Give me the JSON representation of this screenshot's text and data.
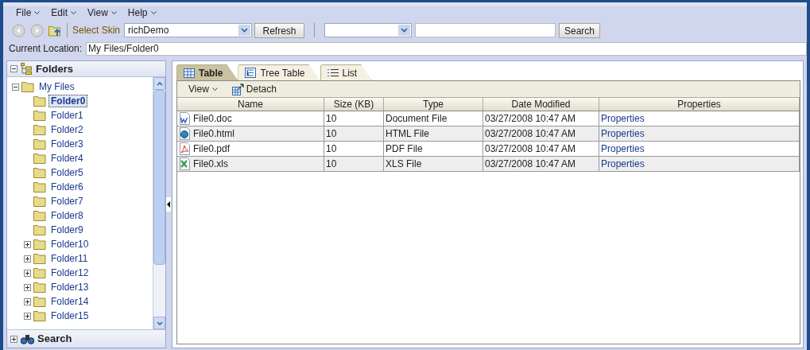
{
  "menu": [
    {
      "label": "File"
    },
    {
      "label": "Edit"
    },
    {
      "label": "View"
    },
    {
      "label": "Help"
    }
  ],
  "toolbar": {
    "skin_label": "Select Skin",
    "skin_value": "richDemo",
    "refresh": "Refresh",
    "search_button": "Search"
  },
  "location": {
    "label": "Current Location:",
    "value": "My Files/Folder0"
  },
  "folders_panel": {
    "title": "Folders",
    "expanded": true,
    "tree": [
      {
        "label": "My Files",
        "expanded": true,
        "selected": false,
        "children": [
          {
            "label": "Folder0",
            "selected": true
          },
          {
            "label": "Folder1",
            "selected": false
          },
          {
            "label": "Folder2",
            "selected": false
          },
          {
            "label": "Folder3",
            "selected": false
          },
          {
            "label": "Folder4",
            "selected": false
          },
          {
            "label": "Folder5",
            "selected": false
          },
          {
            "label": "Folder6",
            "selected": false
          },
          {
            "label": "Folder7",
            "selected": false
          },
          {
            "label": "Folder8",
            "selected": false
          },
          {
            "label": "Folder9",
            "selected": false
          },
          {
            "label": "Folder10",
            "selected": false,
            "expanded": false
          },
          {
            "label": "Folder11",
            "selected": false,
            "expanded": false
          },
          {
            "label": "Folder12",
            "selected": false,
            "expanded": false
          },
          {
            "label": "Folder13",
            "selected": false,
            "expanded": false
          },
          {
            "label": "Folder14",
            "selected": false,
            "expanded": false
          },
          {
            "label": "Folder15",
            "selected": false,
            "expanded": false
          }
        ]
      }
    ]
  },
  "search_panel": {
    "title": "Search",
    "expanded": false
  },
  "tabs": [
    {
      "label": "Table",
      "kind": "table",
      "selected": true
    },
    {
      "label": "Tree Table",
      "kind": "treetable",
      "selected": false
    },
    {
      "label": "List",
      "kind": "list",
      "selected": false
    }
  ],
  "table_toolbar": {
    "view": "View",
    "detach": "Detach"
  },
  "table": {
    "columns": [
      "Name",
      "Size (KB)",
      "Type",
      "Date Modified",
      "Properties"
    ],
    "rows": [
      {
        "kind": "doc",
        "name": "File0.doc",
        "size": "10",
        "type": "Document File",
        "date": "03/27/2008 10:47 AM",
        "link": "Properties"
      },
      {
        "kind": "html",
        "name": "File0.html",
        "size": "10",
        "type": "HTML File",
        "date": "03/27/2008 10:47 AM",
        "link": "Properties"
      },
      {
        "kind": "pdf",
        "name": "File0.pdf",
        "size": "10",
        "type": "PDF File",
        "date": "03/27/2008 10:47 AM",
        "link": "Properties"
      },
      {
        "kind": "xls",
        "name": "File0.xls",
        "size": "10",
        "type": "XLS File",
        "date": "03/27/2008 10:47 AM",
        "link": "Properties"
      }
    ]
  }
}
